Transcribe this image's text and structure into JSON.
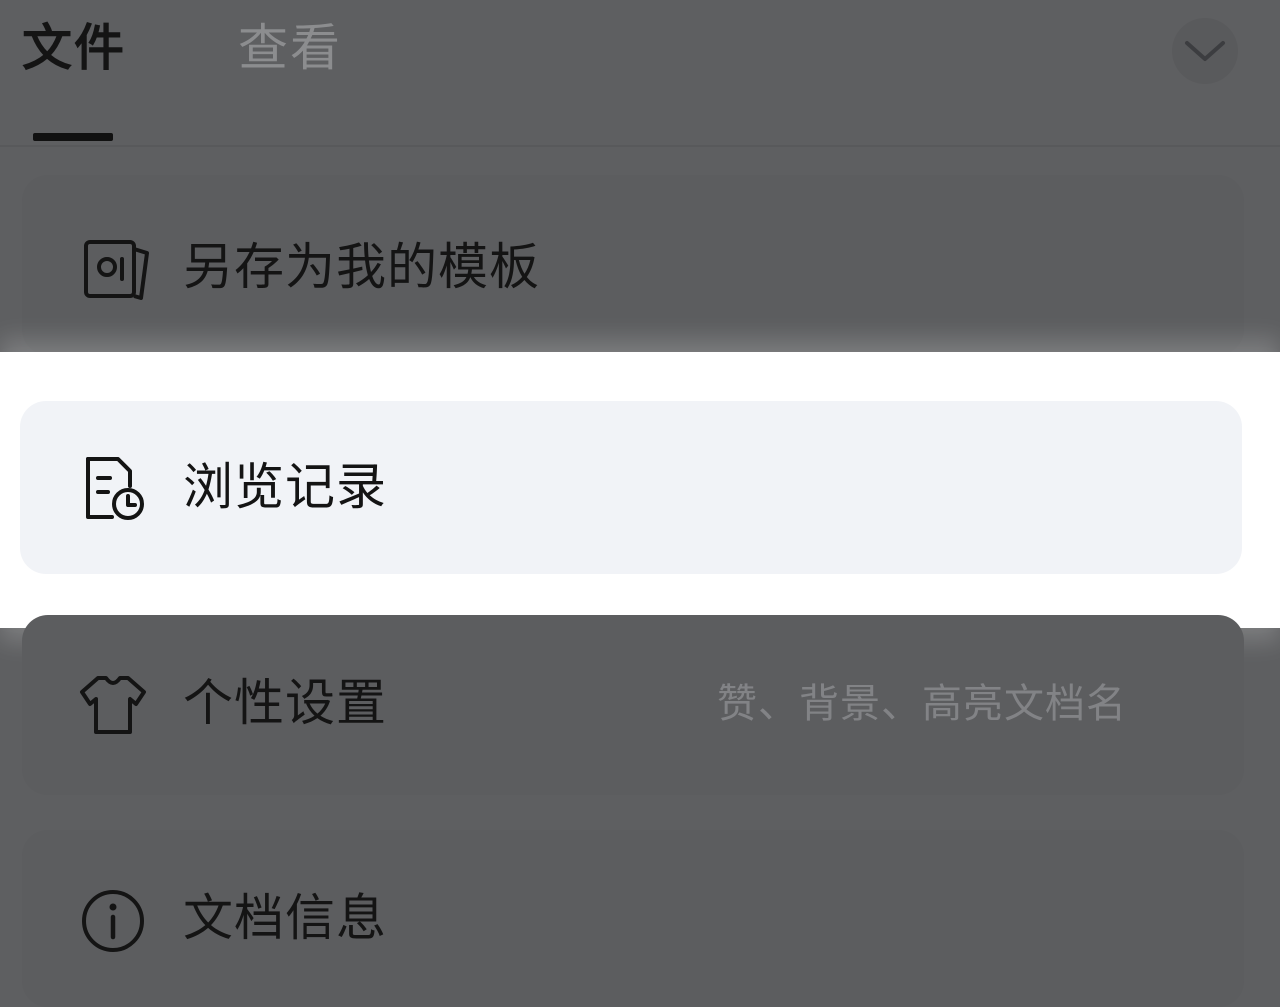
{
  "tabs": [
    {
      "label": "文件",
      "active": true
    },
    {
      "label": "查看",
      "active": false
    }
  ],
  "collapse_icon": "chevron-down-icon",
  "menu": {
    "save_template": {
      "label": "另存为我的模板",
      "icon": "template-icon"
    },
    "history": {
      "label": "浏览记录",
      "icon": "history-icon",
      "highlighted": true
    },
    "settings": {
      "label": "个性设置",
      "hint": "赞、背景、高亮文档名",
      "icon": "shirt-icon"
    },
    "info": {
      "label": "文档信息",
      "icon": "info-icon"
    }
  },
  "colors": {
    "dim_overlay": "#5e5f61",
    "highlight_band": "#ffffff",
    "highlight_card": "#f1f3f7",
    "text_primary": "#141414",
    "text_hint": "#828386"
  }
}
